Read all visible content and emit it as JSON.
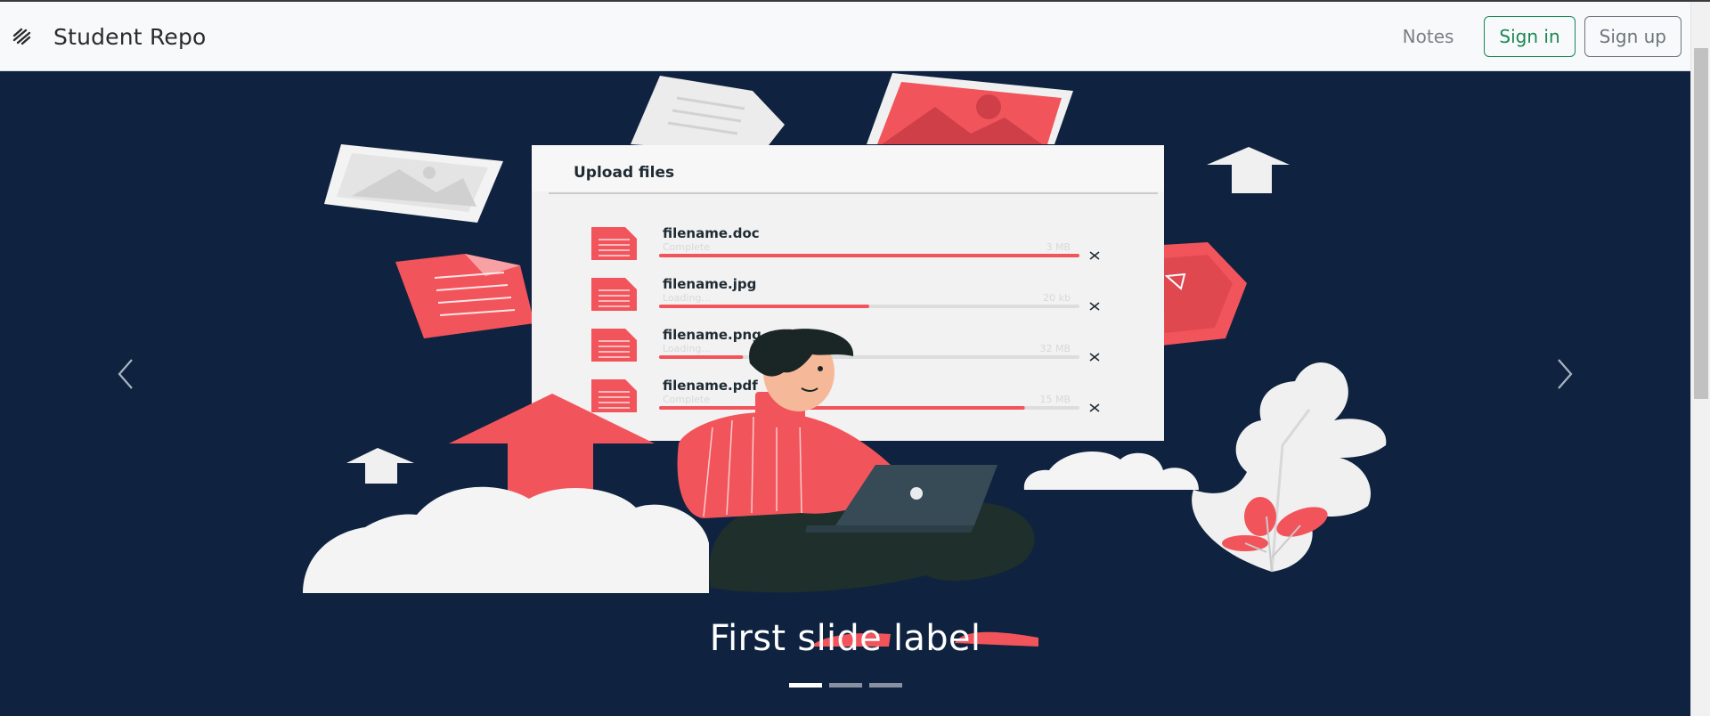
{
  "navbar": {
    "brand_icon": "stripes-logo-icon",
    "brand": "Student Repo",
    "links": {
      "notes": "Notes"
    },
    "buttons": {
      "sign_in": "Sign in",
      "sign_up": "Sign up"
    }
  },
  "carousel": {
    "slide_caption": "First slide label",
    "controls": {
      "prev_icon": "chevron-left-icon",
      "next_icon": "chevron-right-icon"
    },
    "indicator_count": 3,
    "active_indicator": 1,
    "upload_panel": {
      "title": "Upload files",
      "files": [
        {
          "name": "filename.doc",
          "status": "Complete",
          "size": "3 MB",
          "progress": 1.0
        },
        {
          "name": "filename.jpg",
          "status": "Loading...",
          "size": "20 kb",
          "progress": 0.5
        },
        {
          "name": "filename.png",
          "status": "Loading...",
          "size": "32 MB",
          "progress": 0.2
        },
        {
          "name": "filename.pdf",
          "status": "Complete",
          "size": "15 MB",
          "progress": 0.87
        }
      ]
    }
  },
  "colors": {
    "hero_bg": "#0f2340",
    "accent_red": "#f2545b",
    "success_green": "#198754",
    "muted_gray": "#6c757d"
  }
}
